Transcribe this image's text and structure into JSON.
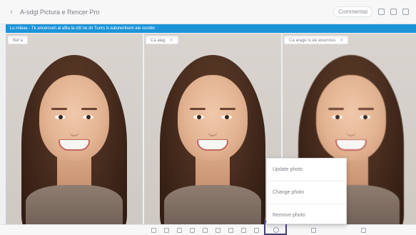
{
  "titlebar": {
    "back_icon": "back-arrow-icon",
    "title": "A-sdgl Pictura e Rencer Pro",
    "right_pill": "Commentai",
    "icons": [
      "close-icon",
      "settings-icon",
      "more-icon"
    ]
  },
  "notice": {
    "text": "Lu roleas - Tk anceroum al aflia la cttt ne sh Tunrs ls ealunerlnem ale sonder"
  },
  "panels": [
    {
      "label": "Bef a"
    },
    {
      "label": "Ca alag"
    },
    {
      "label": "Ca arage lu ee aluunnus"
    }
  ],
  "context_menu": {
    "items": [
      "Update photo",
      "Change photo",
      "Remove photo"
    ]
  },
  "toolbar": {
    "icons": [
      "list-icon",
      "grid-icon",
      "crop-icon",
      "rotate-icon",
      "adjust-icon",
      "color-icon",
      "filter-icon",
      "info-icon",
      "camera-icon",
      "photo-options-icon",
      "search-icon",
      "zoom-icon"
    ]
  }
}
